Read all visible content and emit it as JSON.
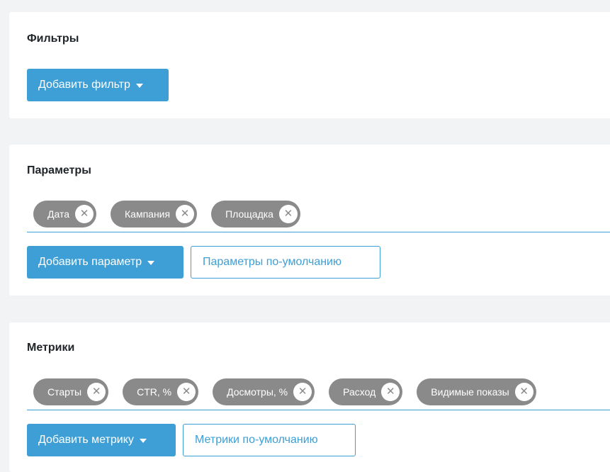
{
  "filters": {
    "title": "Фильтры",
    "add_button": "Добавить фильтр"
  },
  "parameters": {
    "title": "Параметры",
    "tags": [
      {
        "label": "Дата"
      },
      {
        "label": "Кампания"
      },
      {
        "label": "Площадка"
      }
    ],
    "add_button": "Добавить параметр",
    "default_button": "Параметры по-умолчанию"
  },
  "metrics": {
    "title": "Метрики",
    "tags": [
      {
        "label": "Старты"
      },
      {
        "label": "CTR, %"
      },
      {
        "label": "Досмотры, %"
      },
      {
        "label": "Расход"
      },
      {
        "label": "Видимые показы"
      }
    ],
    "add_button": "Добавить метрику",
    "default_button": "Метрики по-умолчанию"
  },
  "icons": {
    "remove": "close-circle-icon",
    "dropdown": "caret-down-icon"
  },
  "colors": {
    "accent": "#3e9ed6",
    "tag_bg": "#8a8a8a",
    "page_bg": "#f2f3f5"
  }
}
